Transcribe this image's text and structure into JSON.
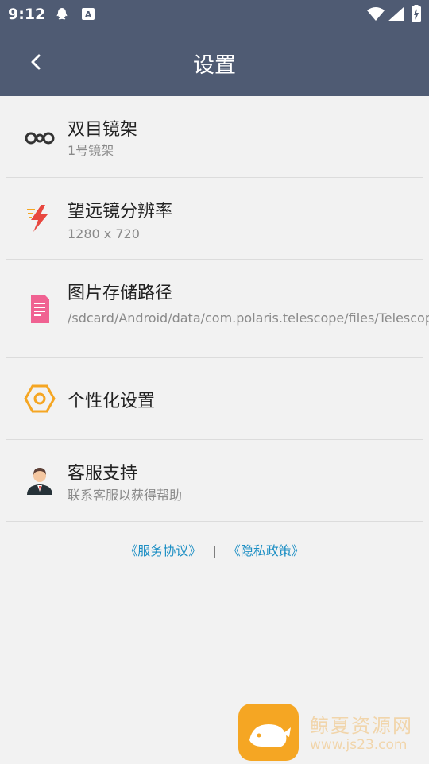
{
  "status": {
    "time": "9:12"
  },
  "appbar": {
    "title": "设置"
  },
  "items": [
    {
      "title": "双目镜架",
      "subtitle": "1号镜架",
      "icon": "binoculars-icon"
    },
    {
      "title": "望远镜分辨率",
      "subtitle": "1280 x 720",
      "icon": "lightning-icon"
    },
    {
      "title": "图片存储路径",
      "subtitle": "/sdcard/Android/data/com.polaris.telescope/files/Telescope/",
      "icon": "document-icon"
    },
    {
      "title": "个性化设置",
      "subtitle": "",
      "icon": "hexagon-settings-icon"
    },
    {
      "title": "客服支持",
      "subtitle": "联系客服以获得帮助",
      "icon": "support-agent-icon"
    }
  ],
  "links": {
    "service": "《服务协议》",
    "separator": "|",
    "privacy": "《隐私政策》"
  },
  "watermark": {
    "line1": "鲸夏资源网",
    "line2": "www.js23.com"
  },
  "colors": {
    "appbar": "#4f5b73",
    "background": "#f2f2f2",
    "link": "#1d8fc4"
  }
}
